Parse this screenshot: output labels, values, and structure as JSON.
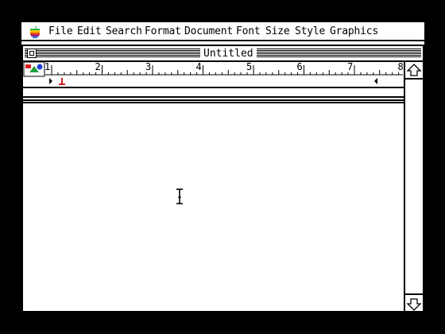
{
  "menubar": {
    "items": [
      {
        "label": "File"
      },
      {
        "label": "Edit"
      },
      {
        "label": "Search"
      },
      {
        "label": "Format"
      },
      {
        "label": "Document"
      },
      {
        "label": "Font"
      },
      {
        "label": "Size"
      },
      {
        "label": "Style"
      },
      {
        "label": "Graphics"
      }
    ]
  },
  "window": {
    "title": "Untitled"
  },
  "ruler": {
    "tick_labels": [
      "1",
      "2",
      "3",
      "4",
      "5",
      "6",
      "7",
      "8"
    ]
  },
  "icons": {
    "apple": "apple-logo-icon",
    "close": "close-box-icon",
    "scroll_up": "up-arrow-icon",
    "scroll_down": "down-arrow-icon",
    "color": "color-palette-icon",
    "cursor": "i-beam-cursor-icon"
  }
}
